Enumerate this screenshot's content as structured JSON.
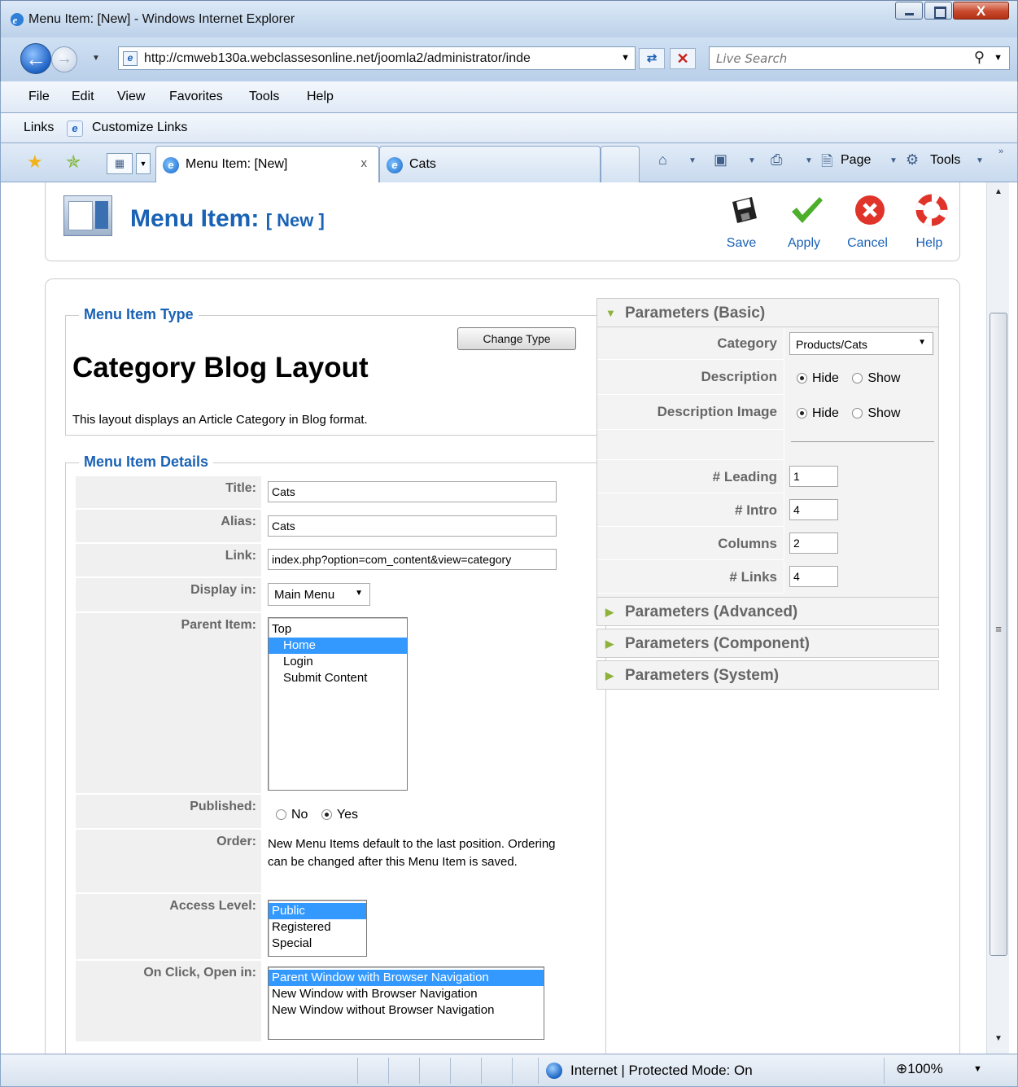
{
  "window": {
    "title": "Menu Item: [New] - Windows Internet Explorer",
    "close_label": "X"
  },
  "address": {
    "url": "http://cmweb130a.webclassesonline.net/joomla2/administrator/inde",
    "search_placeholder": "Live Search"
  },
  "menu": [
    "File",
    "Edit",
    "View",
    "Favorites",
    "Tools",
    "Help"
  ],
  "links": {
    "label": "Links",
    "item": "Customize Links"
  },
  "tabs": [
    {
      "label": "Menu Item: [New]",
      "close": "x"
    },
    {
      "label": "Cats"
    }
  ],
  "commands": {
    "page": "Page",
    "tools": "Tools"
  },
  "toolbar": {
    "heading": "Menu Item:",
    "heading_sub": "[ New ]",
    "save": "Save",
    "apply": "Apply",
    "cancel": "Cancel",
    "help": "Help"
  },
  "menu_item_type": {
    "legend": "Menu Item Type",
    "change_button": "Change Type",
    "layout_title": "Category Blog Layout",
    "layout_desc": "This layout displays an Article Category in Blog format."
  },
  "details": {
    "legend": "Menu Item Details",
    "title_label": "Title:",
    "title_value": "Cats",
    "alias_label": "Alias:",
    "alias_value": "Cats",
    "link_label": "Link:",
    "link_value": "index.php?option=com_content&view=category",
    "display_label": "Display in:",
    "display_value": "Main Menu",
    "parent_label": "Parent Item:",
    "parent_items": [
      "Top",
      "Home",
      "Login",
      "Submit Content"
    ],
    "parent_selected": "Home",
    "published_label": "Published:",
    "published_no": "No",
    "published_yes": "Yes",
    "published_value": "Yes",
    "order_label": "Order:",
    "order_text": "New Menu Items default to the last position. Ordering can be changed after this Menu Item is saved.",
    "access_label": "Access Level:",
    "access_items": [
      "Public",
      "Registered",
      "Special"
    ],
    "access_selected": "Public",
    "onclick_label": "On Click, Open in:",
    "onclick_items": [
      "Parent Window with Browser Navigation",
      "New Window with Browser Navigation",
      "New Window without Browser Navigation"
    ],
    "onclick_selected": "Parent Window with Browser Navigation"
  },
  "params_basic": {
    "title": "Parameters (Basic)",
    "category_label": "Category",
    "category_value": "Products/Cats",
    "description_label": "Description",
    "description_value": "Hide",
    "desc_image_label": "Description Image",
    "desc_image_value": "Hide",
    "hide": "Hide",
    "show": "Show",
    "leading_label": "# Leading",
    "leading_value": "1",
    "intro_label": "# Intro",
    "intro_value": "4",
    "columns_label": "Columns",
    "columns_value": "2",
    "links_label": "# Links",
    "links_value": "4"
  },
  "params_other": [
    "Parameters (Advanced)",
    "Parameters (Component)",
    "Parameters (System)"
  ],
  "status": {
    "zone": "Internet | Protected Mode: On",
    "zoom": "100%"
  },
  "colors": {
    "accent": "#1a62b5",
    "selection": "#3399ff",
    "param_arrow": "#8cb23a"
  }
}
